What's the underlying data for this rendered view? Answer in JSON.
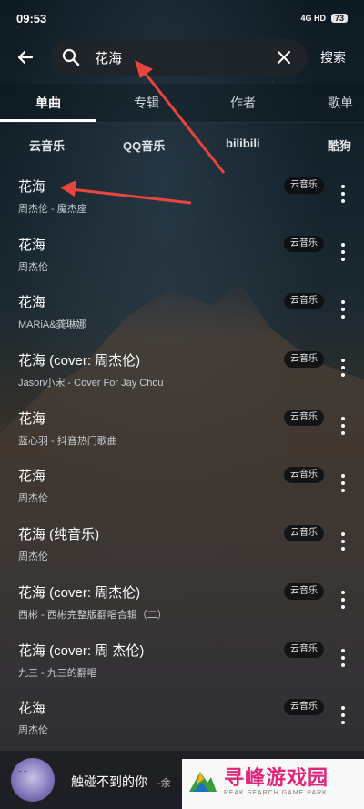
{
  "status": {
    "time": "09:53",
    "network": "4G HD",
    "battery": "73"
  },
  "search": {
    "query": "花海",
    "submit_label": "搜索"
  },
  "tabs": [
    "单曲",
    "专辑",
    "作者",
    "歌单"
  ],
  "sources": [
    "云音乐",
    "QQ音乐",
    "bilibili",
    "酷狗"
  ],
  "songs": [
    {
      "title": "花海",
      "subtitle": "周杰伦 - 魔杰座",
      "badge": "云音乐"
    },
    {
      "title": "花海",
      "subtitle": "周杰伦",
      "badge": "云音乐"
    },
    {
      "title": "花海",
      "subtitle": "MARiA&龚琳娜",
      "badge": "云音乐"
    },
    {
      "title": "花海 (cover: 周杰伦)",
      "subtitle": "Jason小宋 - Cover For Jay Chou",
      "badge": "云音乐"
    },
    {
      "title": "花海",
      "subtitle": "蓝心羽 - 抖音热门歌曲",
      "badge": "云音乐"
    },
    {
      "title": "花海",
      "subtitle": "周杰伦",
      "badge": "云音乐"
    },
    {
      "title": "花海 (纯音乐)",
      "subtitle": "周杰伦",
      "badge": "云音乐"
    },
    {
      "title": "花海 (cover: 周杰伦)",
      "subtitle": "西彬 - 西彬完整版翻唱合辑（二）",
      "badge": "云音乐"
    },
    {
      "title": "花海 (cover: 周 杰伦)",
      "subtitle": "九三 - 九三的翻唱",
      "badge": "云音乐"
    },
    {
      "title": "花海",
      "subtitle": "周杰伦",
      "badge": "云音乐"
    }
  ],
  "now_playing": {
    "title": "触碰不到的你",
    "artist": "-余"
  },
  "watermark": {
    "title": "寻峰游戏园",
    "subtitle": "PEAK SEARCH GAME PARK"
  },
  "colors": {
    "accent": "#ffffff",
    "watermark": "#e0267a",
    "annotation_arrow": "#e8453c"
  }
}
